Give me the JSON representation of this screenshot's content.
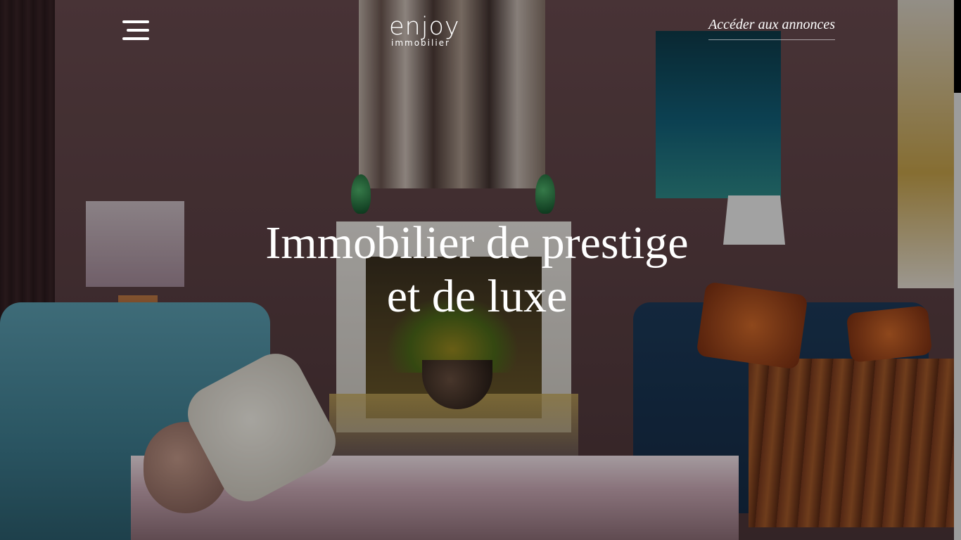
{
  "header": {
    "menu_icon": "hamburger-menu-icon",
    "logo": {
      "name": "enjoy",
      "tagline": "immobilier"
    },
    "listings_link_label": "Accéder aux annonces"
  },
  "hero": {
    "title_line1": "Immobilier de prestige",
    "title_line2": "et de luxe",
    "background_image": "luxury living room with fireplace, blue velvet sofas and pink daybed"
  },
  "colors": {
    "text": "#ffffff",
    "wall": "#5e4246",
    "overlay": "rgba(0,0,0,0.32)"
  }
}
